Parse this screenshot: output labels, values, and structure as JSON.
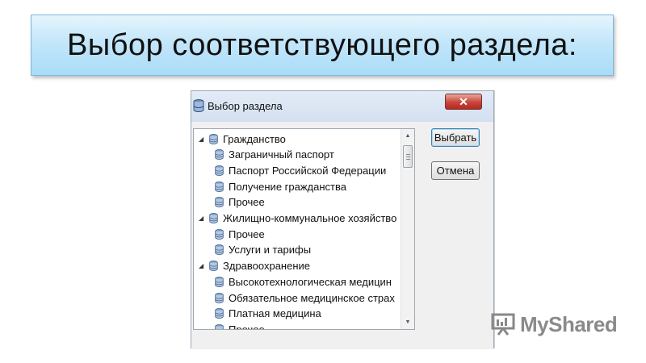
{
  "slide": {
    "title": "Выбор соответствующего раздела:"
  },
  "dialog": {
    "title": "Выбор раздела",
    "close_symbol": "✕",
    "buttons": {
      "select": "Выбрать",
      "cancel": "Отмена"
    },
    "tree": [
      {
        "label": "Гражданство",
        "level": 0,
        "expanded": true
      },
      {
        "label": "Заграничный паспорт",
        "level": 1
      },
      {
        "label": "Паспорт Российской Федерации",
        "level": 1
      },
      {
        "label": "Получение гражданства",
        "level": 1
      },
      {
        "label": "Прочее",
        "level": 1
      },
      {
        "label": "Жилищно-коммунальное хозяйство",
        "level": 0,
        "expanded": true
      },
      {
        "label": "Прочее",
        "level": 1
      },
      {
        "label": "Услуги и тарифы",
        "level": 1
      },
      {
        "label": "Здравоохранение",
        "level": 0,
        "expanded": true
      },
      {
        "label": "Высокотехнологическая медицин",
        "level": 1
      },
      {
        "label": "Обязательное медицинское страх",
        "level": 1
      },
      {
        "label": "Платная медицина",
        "level": 1
      },
      {
        "label": "Прочее",
        "level": 1
      }
    ],
    "icons": {
      "window": "database-icon",
      "node": "database-icon",
      "expanded": "expanded-triangle-icon"
    }
  },
  "watermark": {
    "text": "MyShared",
    "icon": "presentation-board-icon"
  }
}
